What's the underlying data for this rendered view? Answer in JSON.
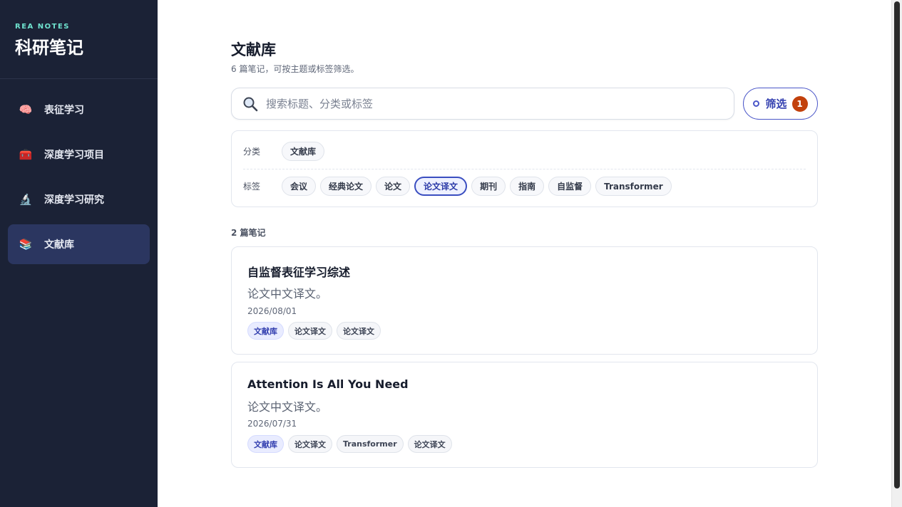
{
  "brand": {
    "sub": "REA NOTES",
    "title": "科研笔记"
  },
  "sidebar": {
    "items": [
      {
        "label": "表征学习",
        "icon": "brain-icon",
        "glyph": "🧠"
      },
      {
        "label": "深度学习项目",
        "icon": "toolbox-icon",
        "glyph": "🧰"
      },
      {
        "label": "深度学习研究",
        "icon": "microscope-icon",
        "glyph": "🔬"
      },
      {
        "label": "文献库",
        "icon": "books-icon",
        "glyph": "📚",
        "active": true
      }
    ]
  },
  "page": {
    "title": "文献库",
    "subtitle": "6 篇笔记，可按主题或标签筛选。"
  },
  "search": {
    "placeholder": "搜索标题、分类或标签",
    "value": ""
  },
  "filter_button": {
    "label": "筛选",
    "badge": "1"
  },
  "filters": {
    "category_label": "分类",
    "categories": [
      "文献库"
    ],
    "tag_label": "标签",
    "tags": [
      "会议",
      "经典论文",
      "论文",
      "论文译文",
      "期刊",
      "指南",
      "自监督",
      "Transformer"
    ],
    "selected_tag": "论文译文"
  },
  "results": {
    "count_label": "2 篇笔记",
    "notes": [
      {
        "title": "自监督表征学习综述",
        "desc": "论文中文译文。",
        "date": "2026/08/01",
        "category": "文献库",
        "tags": [
          "论文译文",
          "论文译文"
        ]
      },
      {
        "title": "Attention Is All You Need",
        "desc": "论文中文译文。",
        "date": "2026/07/31",
        "category": "文献库",
        "tags": [
          "论文译文",
          "Transformer",
          "论文译文"
        ]
      }
    ]
  },
  "colors": {
    "sidebar_bg": "#1b2236",
    "accent": "#3a4ec0",
    "badge": "#c2410c",
    "brand_sub": "#6fe3cf"
  }
}
